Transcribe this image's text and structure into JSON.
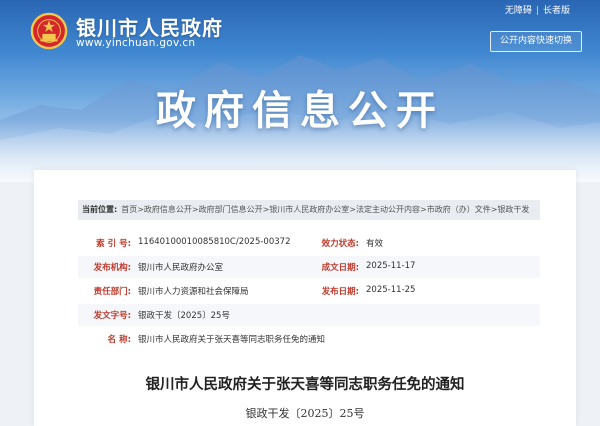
{
  "header": {
    "site_title": "银川市人民政府",
    "site_url": "www.yinchuan.gov.cn",
    "accessibility_link": "无障碍",
    "elderly_link": "长者版",
    "separator": "|",
    "quick_switch_label": "公开内容快速切换",
    "banner_title": "政府信息公开"
  },
  "breadcrumb": {
    "label": "当前位置:",
    "path": "首页>政府信息公开>政府部门信息公开>银川市人民政府办公室>法定主动公开内容>市政府（办）文件>银政干发"
  },
  "meta": {
    "index_label": "索 引 号:",
    "index_value": "11640100010085810C/2025-00372",
    "status_label": "效力状态:",
    "status_value": "有效",
    "publisher_label": "发布机构:",
    "publisher_value": "银川市人民政府办公室",
    "created_label": "成文日期:",
    "created_value": "2025-11-17",
    "responsible_label": "责任部门:",
    "responsible_value": "银川市人力资源和社会保障局",
    "published_label": "发布日期:",
    "published_value": "2025-11-25",
    "docno_label": "发文字号:",
    "docno_value": "银政干发〔2025〕25号",
    "name_label": "名  称:",
    "name_value": "银川市人民政府关于张天喜等同志职务任免的通知"
  },
  "document": {
    "title": "银川市人民政府关于张天喜等同志职务任免的通知",
    "number": "银政干发〔2025〕25号"
  },
  "colors": {
    "accent_red": "#c0392b",
    "banner_blue": "#2a66b4"
  },
  "icons": {
    "emblem": "national-emblem-icon",
    "quick_switch": "list-icon"
  }
}
